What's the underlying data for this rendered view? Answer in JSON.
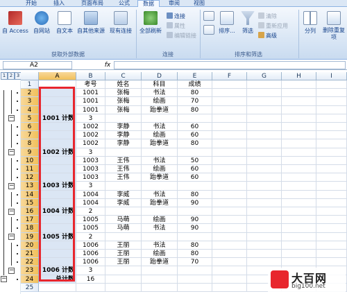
{
  "ribbon": {
    "tabs": [
      "开始",
      "插入",
      "页面布局",
      "公式",
      "数据",
      "审阅",
      "视图"
    ],
    "active_tab": "数据",
    "groups": {
      "external": {
        "label": "获取外部数据",
        "buttons": [
          "自 Access",
          "自网站",
          "自文本",
          "自其他来源",
          "现有连接"
        ]
      },
      "connections": {
        "label": "连接",
        "refresh": "全部刷新",
        "small": [
          "连接",
          "属性",
          "编辑链接"
        ]
      },
      "sort_filter": {
        "label": "排序和筛选",
        "sort": "排序...",
        "filter": "筛选",
        "small": [
          "清除",
          "重新应用",
          "高级"
        ]
      },
      "tools": {
        "split": "分列",
        "remove_dup": "删除重复项"
      }
    }
  },
  "formula_bar": {
    "name_box": "A2",
    "fx": "fx",
    "formula": ""
  },
  "columns": [
    "A",
    "B",
    "C",
    "D",
    "E",
    "F",
    "G",
    "H",
    "I"
  ],
  "selected_column": "A",
  "outline_levels": [
    "1",
    "2",
    "3"
  ],
  "rows": [
    {
      "n": "1",
      "a": "",
      "b": "考号",
      "c": "姓名",
      "d": "科目",
      "e": "成绩"
    },
    {
      "n": "2",
      "a": "",
      "b": "1001",
      "c": "张梅",
      "d": "书法",
      "e": "80"
    },
    {
      "n": "3",
      "a": "",
      "b": "1001",
      "c": "张梅",
      "d": "绘画",
      "e": "70"
    },
    {
      "n": "4",
      "a": "",
      "b": "1001",
      "c": "张梅",
      "d": "跆拳道",
      "e": "80"
    },
    {
      "n": "5",
      "a": "1001 计数",
      "b": "3",
      "c": "",
      "d": "",
      "e": ""
    },
    {
      "n": "6",
      "a": "",
      "b": "1002",
      "c": "李静",
      "d": "书法",
      "e": "60"
    },
    {
      "n": "7",
      "a": "",
      "b": "1002",
      "c": "李静",
      "d": "绘画",
      "e": "60"
    },
    {
      "n": "8",
      "a": "",
      "b": "1002",
      "c": "李静",
      "d": "跆拳道",
      "e": "80"
    },
    {
      "n": "9",
      "a": "1002 计数",
      "b": "3",
      "c": "",
      "d": "",
      "e": ""
    },
    {
      "n": "10",
      "a": "",
      "b": "1003",
      "c": "王伟",
      "d": "书法",
      "e": "50"
    },
    {
      "n": "11",
      "a": "",
      "b": "1003",
      "c": "王伟",
      "d": "绘画",
      "e": "60"
    },
    {
      "n": "12",
      "a": "",
      "b": "1003",
      "c": "王伟",
      "d": "跆拳道",
      "e": "60"
    },
    {
      "n": "13",
      "a": "1003 计数",
      "b": "3",
      "c": "",
      "d": "",
      "e": ""
    },
    {
      "n": "14",
      "a": "",
      "b": "1004",
      "c": "李威",
      "d": "书法",
      "e": "80"
    },
    {
      "n": "15",
      "a": "",
      "b": "1004",
      "c": "李威",
      "d": "跆拳道",
      "e": "90"
    },
    {
      "n": "16",
      "a": "1004 计数",
      "b": "2",
      "c": "",
      "d": "",
      "e": ""
    },
    {
      "n": "17",
      "a": "",
      "b": "1005",
      "c": "马萌",
      "d": "绘画",
      "e": "90"
    },
    {
      "n": "18",
      "a": "",
      "b": "1005",
      "c": "马萌",
      "d": "书法",
      "e": "90"
    },
    {
      "n": "19",
      "a": "1005 计数",
      "b": "2",
      "c": "",
      "d": "",
      "e": ""
    },
    {
      "n": "20",
      "a": "",
      "b": "1006",
      "c": "王丽",
      "d": "书法",
      "e": "80"
    },
    {
      "n": "21",
      "a": "",
      "b": "1006",
      "c": "王丽",
      "d": "绘画",
      "e": "80"
    },
    {
      "n": "22",
      "a": "",
      "b": "1006",
      "c": "王丽",
      "d": "跆拳道",
      "e": "70"
    },
    {
      "n": "23",
      "a": "1006 计数",
      "b": "3",
      "c": "",
      "d": "",
      "e": ""
    },
    {
      "n": "24",
      "a": "总计数",
      "b": "16",
      "c": "",
      "d": "",
      "e": ""
    },
    {
      "n": "25",
      "a": "",
      "b": "",
      "c": "",
      "d": "",
      "e": ""
    }
  ],
  "watermark": {
    "text": "大百网",
    "url": "big100.net"
  },
  "colors": {
    "highlight_box": "#e8262d",
    "selected_header": "#f1c05a",
    "column_a_fill": "#dbe6f4"
  }
}
